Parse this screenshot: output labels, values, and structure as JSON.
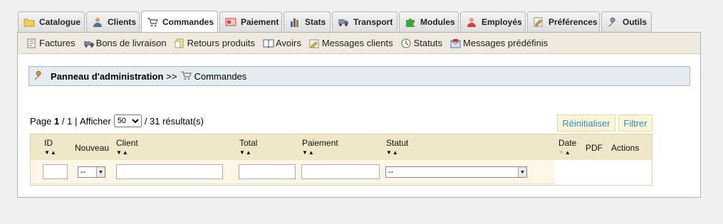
{
  "tabs": [
    {
      "label": "Catalogue",
      "icon": "folder-icon"
    },
    {
      "label": "Clients",
      "icon": "user-icon"
    },
    {
      "label": "Commandes",
      "icon": "cart-icon"
    },
    {
      "label": "Paiement",
      "icon": "payment-icon"
    },
    {
      "label": "Stats",
      "icon": "bar-chart-icon"
    },
    {
      "label": "Transport",
      "icon": "truck-icon"
    },
    {
      "label": "Modules",
      "icon": "puzzle-icon"
    },
    {
      "label": "Employés",
      "icon": "employee-icon"
    },
    {
      "label": "Préférences",
      "icon": "preferences-icon"
    },
    {
      "label": "Outils",
      "icon": "wrench-icon"
    }
  ],
  "active_tab": "Commandes",
  "subnav": [
    {
      "label": "Factures",
      "icon": "invoice-icon"
    },
    {
      "label": "Bons de livraison",
      "icon": "delivery-icon"
    },
    {
      "label": "Retours produits",
      "icon": "return-icon"
    },
    {
      "label": "Avoirs",
      "icon": "book-icon"
    },
    {
      "label": "Messages clients",
      "icon": "message-icon"
    },
    {
      "label": "Statuts",
      "icon": "clock-icon"
    },
    {
      "label": "Messages prédéfinis",
      "icon": "predefined-message-icon"
    }
  ],
  "breadcrumb": {
    "root": "Panneau d'administration",
    "separator": ">>",
    "current": "Commandes"
  },
  "pager": {
    "page_label": "Page",
    "page": "1",
    "of": "/ 1",
    "bar": "|",
    "show_label": "Afficher",
    "per_page": "50",
    "results": "/ 31 résultat(s)"
  },
  "buttons": {
    "reset": "Réinitialiser",
    "filter": "Filtrer"
  },
  "columns": {
    "id": "ID",
    "new": "Nouveau",
    "client": "Client",
    "total": "Total",
    "payment": "Paiement",
    "status": "Statut",
    "date": "Date",
    "pdf": "PDF",
    "actions": "Actions"
  },
  "filters": {
    "new_value": "--",
    "status_value": "--"
  },
  "colors": {
    "accent": "#268ccd",
    "header_bg": "#f0e6c8",
    "breadcrumb_bg": "#e4ecf0"
  }
}
